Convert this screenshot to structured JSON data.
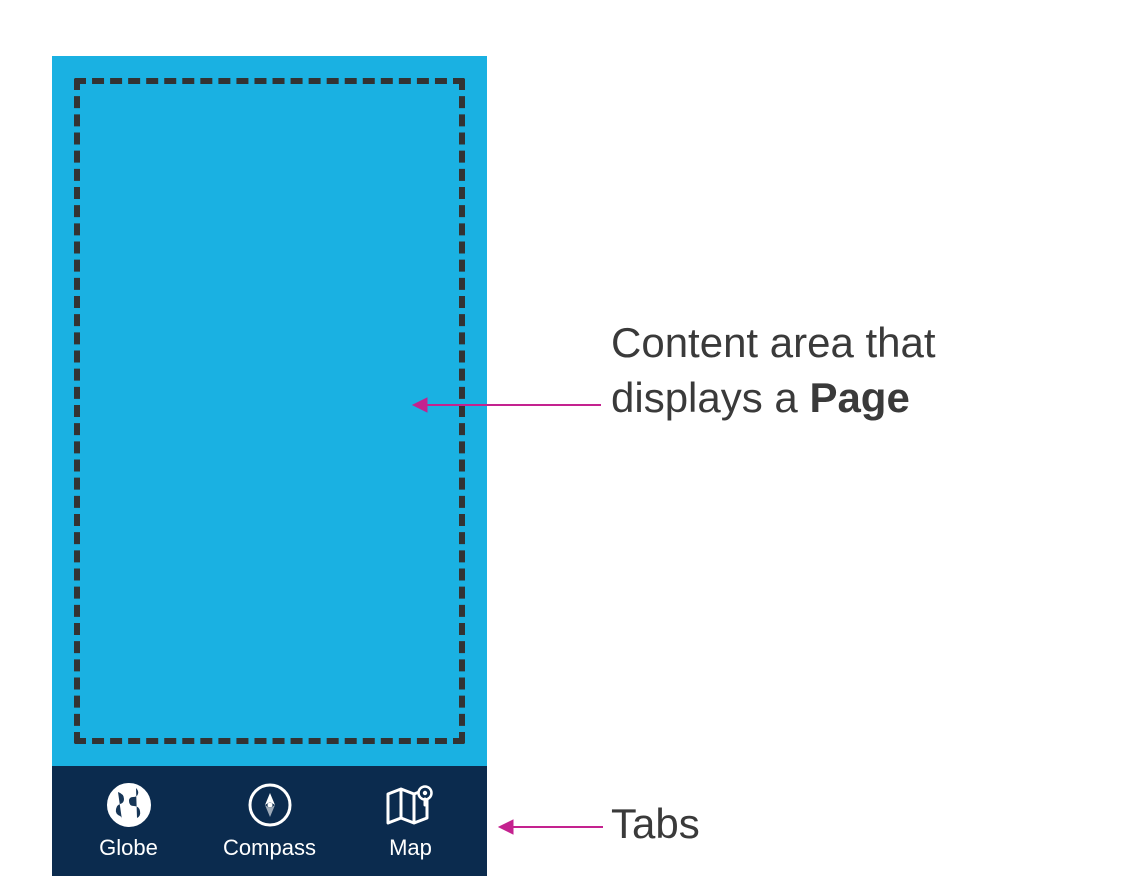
{
  "tabs": [
    {
      "label": "Globe",
      "icon": "globe-icon"
    },
    {
      "label": "Compass",
      "icon": "compass-icon"
    },
    {
      "label": "Map",
      "icon": "map-icon"
    }
  ],
  "annotations": {
    "content_line1": "Content area that",
    "content_line2_pre": "displays a ",
    "content_line2_bold": "Page",
    "tabs_label": "Tabs"
  },
  "colors": {
    "content_bg": "#1ab1e2",
    "tabbar_bg": "#0b2b4e",
    "arrow": "#c4228f"
  }
}
